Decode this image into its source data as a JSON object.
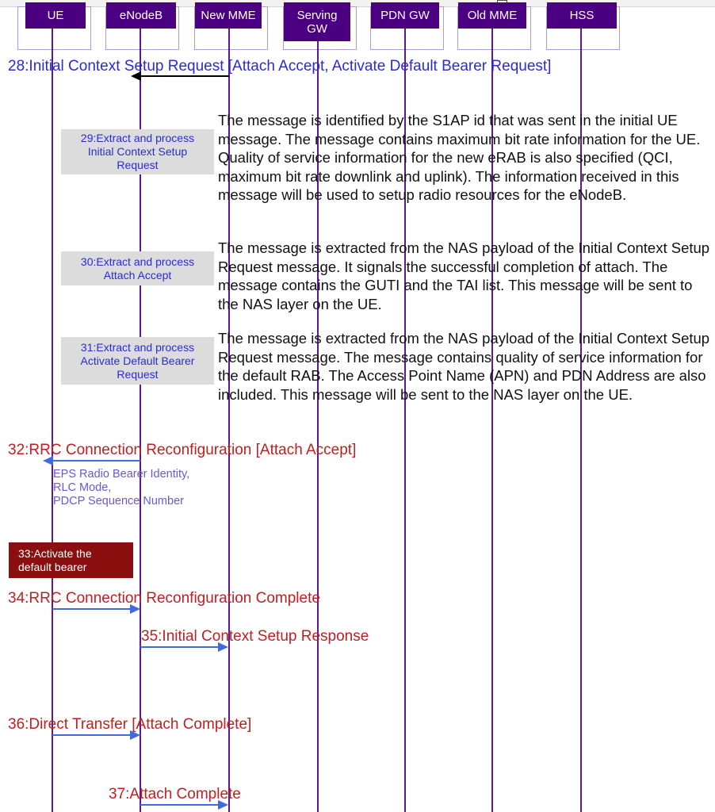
{
  "diagram": {
    "title": "LTE Attach Procedure Sequence Diagram (part)",
    "colors": {
      "participant_fill": "#4b0082",
      "lifeline": "#5b1a8f",
      "frame_border": "#b49ad4",
      "label_blue": "#2b2bd6",
      "label_red": "#c02020",
      "action_box_gray": "#dcdcdc",
      "action_box_dark_red": "#8b0f0f",
      "arrow_blue": "#4169e1",
      "arrow_black": "#000000",
      "subnote_purple": "#6a5acd"
    }
  },
  "participants": [
    {
      "id": "ue",
      "label": "UE"
    },
    {
      "id": "enodeb",
      "label": "eNodeB"
    },
    {
      "id": "new_mme",
      "label": "New MME"
    },
    {
      "id": "serving_gw",
      "label": "Serving\nGW"
    },
    {
      "id": "pdn_gw",
      "label": "PDN GW"
    },
    {
      "id": "old_mme",
      "label": "Old MME"
    },
    {
      "id": "hss",
      "label": "HSS"
    }
  ],
  "messages": [
    {
      "number": "28",
      "label": "28:Initial Context Setup Request [Attach Accept, Activate Default Bearer Request]",
      "from": "new_mme",
      "to": "enodeb",
      "direction": "left",
      "color": "blue",
      "arrow_color": "black"
    },
    {
      "number": "32",
      "label": "32:RRC Connection Reconfiguration [Attach Accept]",
      "from": "enodeb",
      "to": "ue",
      "direction": "left",
      "color": "red",
      "arrow_color": "blue"
    },
    {
      "number": "34",
      "label": "34:RRC Connection Reconfiguration Complete",
      "from": "ue",
      "to": "enodeb",
      "direction": "right",
      "color": "red",
      "arrow_color": "blue"
    },
    {
      "number": "35",
      "label": "35:Initial Context Setup Response",
      "from": "enodeb",
      "to": "new_mme",
      "direction": "right",
      "color": "red",
      "arrow_color": "blue"
    },
    {
      "number": "36",
      "label": "36:Direct Transfer [Attach Complete]",
      "from": "ue",
      "to": "enodeb",
      "direction": "right",
      "color": "red",
      "arrow_color": "blue"
    },
    {
      "number": "37",
      "label": "37:Attach Complete",
      "from": "enodeb",
      "to": "new_mme",
      "direction": "right",
      "color": "red",
      "arrow_color": "blue"
    }
  ],
  "actions": [
    {
      "number": "29",
      "lines": [
        "29:Extract and process",
        "Initial Context Setup",
        "Request"
      ],
      "style": "gray"
    },
    {
      "number": "30",
      "lines": [
        "30:Extract and process",
        "Attach Accept"
      ],
      "style": "gray"
    },
    {
      "number": "31",
      "lines": [
        "31:Extract and process",
        "Activate Default Bearer",
        "Request"
      ],
      "style": "gray"
    },
    {
      "number": "33",
      "lines": [
        "33:Activate the",
        "default bearer"
      ],
      "style": "dark-red"
    }
  ],
  "descriptions": [
    {
      "for_action": "29",
      "text": "The message is identified by the S1AP id that was sent in the initial UE message. The message contains maximum bit rate information for the UE. Quality of service information for the new eRAB is also specified (QCI, maximum bit rate downlink and uplink). The information received in this message will be used to setup radio resources for the eNodeB."
    },
    {
      "for_action": "30",
      "text": "The message is extracted from the NAS payload of the Initial Context Setup Request message. It signals the successful completion of attach. The message contains the GUTI and the TAI list. This message will be sent to the NAS layer on the UE."
    },
    {
      "for_action": "31",
      "text": "The message is extracted from the NAS payload of the Initial Context Setup Request message. The message contains quality of service information for the default RAB. The Access Point Name (APN) and PDN Address are also included. This message will be sent to the NAS layer on the UE."
    }
  ],
  "sub_notes": [
    {
      "for_message": "32",
      "lines": [
        "EPS Radio Bearer Identity,",
        "RLC Mode,",
        "PDCP Sequence Number"
      ],
      "text": "EPS Radio Bearer Identity,\nRLC Mode,\nPDCP Sequence Number"
    }
  ]
}
